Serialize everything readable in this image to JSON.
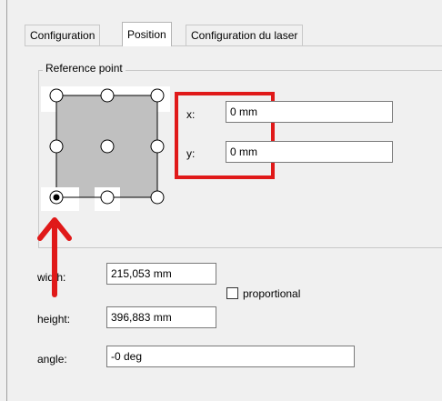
{
  "tabs": [
    {
      "label": "Configuration",
      "active": false
    },
    {
      "label": "Position",
      "active": true
    },
    {
      "label": "Configuration du laser",
      "active": false
    }
  ],
  "reference_point": {
    "title": "Reference point",
    "selected": "bottom-left",
    "highlight_color": "#e01919",
    "arrow_color": "#e01919"
  },
  "fields": {
    "x_label": "x:",
    "x_value": "0 mm",
    "y_label": "y:",
    "y_value": "0 mm",
    "width_label": "width:",
    "width_value": "215,053 mm",
    "height_label": "height:",
    "height_value": "396,883 mm",
    "angle_label": "angle:",
    "angle_value": "-0 deg",
    "proportional_label": "proportional",
    "proportional_checked": false
  }
}
